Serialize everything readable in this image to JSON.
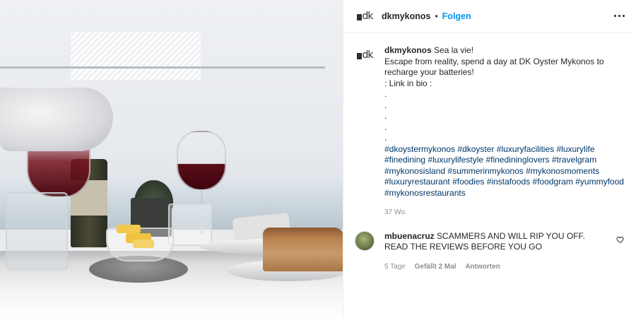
{
  "header": {
    "logo_text": "dk",
    "username": "dkmykonos",
    "separator": "•",
    "follow_label": "Folgen"
  },
  "caption": {
    "username": "dkmykonos",
    "lines": [
      "Sea la vie!",
      "Escape from reality, spend a day at DK Oyster Mykonos to recharge your batteries!",
      ": Link in bio :",
      ".",
      ".",
      ".",
      ".",
      "."
    ],
    "hashtags": [
      "#dkoystermykonos",
      "#dkoyster",
      "#luxuryfacilities",
      "#luxurylife",
      "#finedining",
      "#luxurylifestyle",
      "#finediningl­overs",
      "#travelgram",
      "#mykonosisland",
      "#summerinmykonos",
      "#mykonosmoments",
      "#luxuryrestaurant",
      "#foodies",
      "#instafoods",
      "#foodgram",
      "#yummyfood",
      "#mykonosrestaurants"
    ],
    "timestamp": "37 Wo."
  },
  "comment": {
    "username": "mbuenacruz",
    "text": "SCAMMERS AND WILL RIP YOU OFF. READ THE REVIEWS BEFORE YOU GO",
    "timestamp": "5 Tage",
    "likes": "Gefällt 2 Mal",
    "reply_label": "Antworten"
  },
  "icons": {
    "more": "more-horizontal-icon",
    "like": "heart-outline-icon"
  },
  "colors": {
    "link_blue": "#0095f6",
    "hashtag": "#00376b",
    "meta_gray": "#8e8e8e"
  }
}
